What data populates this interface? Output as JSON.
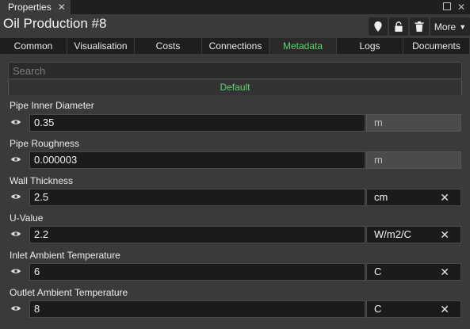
{
  "panel": {
    "tab_label": "Properties"
  },
  "header": {
    "title": "Oil Production #8",
    "more_label": "More"
  },
  "tabs": [
    "Common",
    "Visualisation",
    "Costs",
    "Connections",
    "Metadata",
    "Logs",
    "Documents"
  ],
  "active_tab": "Metadata",
  "search": {
    "placeholder": "Search",
    "value": ""
  },
  "group_label": "Default",
  "fields": [
    {
      "label": "Pipe Inner Diameter",
      "value": "0.35",
      "unit": "m"
    },
    {
      "label": "Pipe Roughness",
      "value": "0.000003",
      "unit": "m"
    },
    {
      "label": "Wall Thickness",
      "value": "2.5",
      "unit": "cm"
    },
    {
      "label": "U-Value",
      "value": "2.2",
      "unit": "W/m2/C"
    },
    {
      "label": "Inlet Ambient Temperature",
      "value": "6",
      "unit": "C"
    },
    {
      "label": "Outlet Ambient Temperature",
      "value": "8",
      "unit": "C"
    }
  ],
  "colors": {
    "accent": "#5fd16d",
    "background": "#3a3a3a"
  }
}
